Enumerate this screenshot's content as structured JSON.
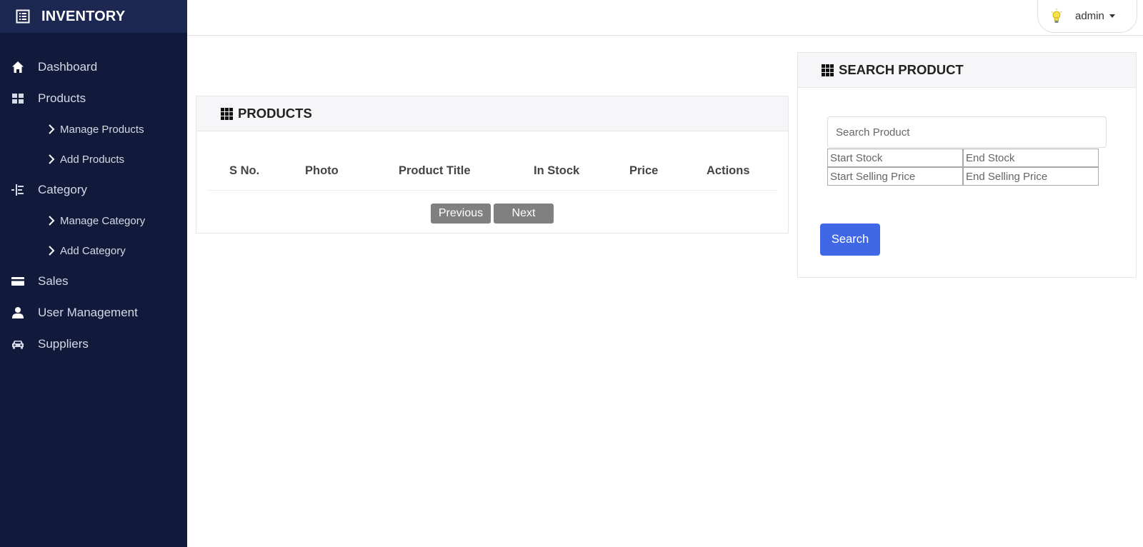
{
  "brand": {
    "title": "INVENTORY",
    "icon": "list-icon"
  },
  "sidebar": {
    "items": [
      {
        "label": "Dashboard",
        "icon": "home-icon"
      },
      {
        "label": "Products",
        "icon": "grid-icon"
      },
      {
        "label": "Manage Products"
      },
      {
        "label": "Add Products"
      },
      {
        "label": "Category",
        "icon": "indent-icon"
      },
      {
        "label": "Manage Category"
      },
      {
        "label": "Add Category"
      },
      {
        "label": "Sales",
        "icon": "credit-card-icon"
      },
      {
        "label": "User Management",
        "icon": "user-icon"
      },
      {
        "label": "Suppliers",
        "icon": "car-icon"
      }
    ]
  },
  "topbar": {
    "user": "admin",
    "icon": "lightbulb-icon"
  },
  "products_panel": {
    "title": "PRODUCTS",
    "columns": [
      "S No.",
      "Photo",
      "Product Title",
      "In Stock",
      "Price",
      "Actions"
    ],
    "rows": [],
    "prev_label": "Previous",
    "next_label": "Next"
  },
  "search_panel": {
    "title": "SEARCH PRODUCT",
    "search_placeholder": "Search Product",
    "start_stock_placeholder": "Start Stock",
    "end_stock_placeholder": "End Stock",
    "start_price_placeholder": "Start Selling Price",
    "end_price_placeholder": "End Selling Price",
    "button_label": "Search"
  },
  "colors": {
    "sidebar_bg": "#111a3a",
    "brand_bg": "#1c2752",
    "search_button": "#4068e6",
    "pager_button": "#808080"
  }
}
